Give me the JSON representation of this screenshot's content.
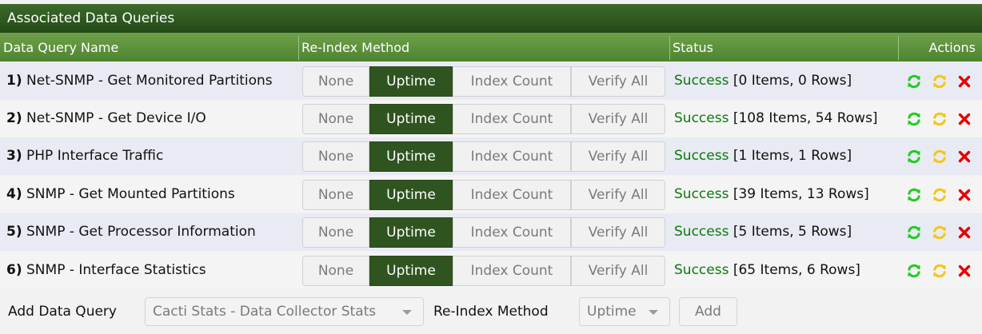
{
  "panel": {
    "title": "Associated Data Queries",
    "headers": {
      "name": "Data Query Name",
      "method": "Re-Index Method",
      "status": "Status",
      "actions": "Actions"
    }
  },
  "method_options": [
    "None",
    "Uptime",
    "Index Count",
    "Verify All"
  ],
  "rows": [
    {
      "num": "1)",
      "name": "Net-SNMP - Get Monitored Partitions",
      "method": "Uptime",
      "status_word": "Success",
      "status_detail": "[0 Items, 0 Rows]"
    },
    {
      "num": "2)",
      "name": "Net-SNMP - Get Device I/O",
      "method": "Uptime",
      "status_word": "Success",
      "status_detail": "[108 Items, 54 Rows]"
    },
    {
      "num": "3)",
      "name": "PHP Interface Traffic",
      "method": "Uptime",
      "status_word": "Success",
      "status_detail": "[1 Items, 1 Rows]"
    },
    {
      "num": "4)",
      "name": "SNMP - Get Mounted Partitions",
      "method": "Uptime",
      "status_word": "Success",
      "status_detail": "[39 Items, 13 Rows]"
    },
    {
      "num": "5)",
      "name": "SNMP - Get Processor Information",
      "method": "Uptime",
      "status_word": "Success",
      "status_detail": "[5 Items, 5 Rows]"
    },
    {
      "num": "6)",
      "name": "SNMP - Interface Statistics",
      "method": "Uptime",
      "status_word": "Success",
      "status_detail": "[65 Items, 6 Rows]"
    }
  ],
  "actions": [
    "reload-icon",
    "verbose-reload-icon",
    "delete-icon"
  ],
  "colors": {
    "success": "#0b7a0b",
    "reload": "#22cc22",
    "verbose_reload": "#f5c518",
    "delete": "#e60000",
    "active_method": "#2f5420"
  },
  "footer": {
    "add_label": "Add Data Query",
    "query_select": "Cacti Stats - Data Collector Stats",
    "method_label": "Re-Index Method",
    "method_select": "Uptime",
    "add_button": "Add"
  }
}
